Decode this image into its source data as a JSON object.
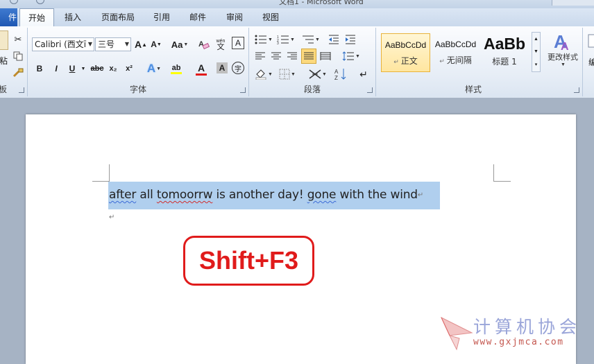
{
  "window": {
    "title": "文档1 - Microsoft Word"
  },
  "ribbon_tabs": {
    "file": "件",
    "items": [
      "开始",
      "插入",
      "页面布局",
      "引用",
      "邮件",
      "审阅",
      "视图"
    ],
    "active": "开始"
  },
  "clipboard": {
    "label": "板",
    "paste_label": "粘"
  },
  "font_group": {
    "label": "字体",
    "font_name": "Calibri (西文正文)",
    "font_name_shown": "Calibri (西文ī",
    "font_size": "三号",
    "grow": "A",
    "shrink": "A",
    "change_case": "Aa",
    "clear_format": "A",
    "phonetic": "wén",
    "char_border": "A",
    "bold": "B",
    "italic": "I",
    "underline": "U",
    "strikethrough": "abc",
    "subscript": "x₂",
    "superscript": "x²",
    "text_effects": "A",
    "highlight": "ab",
    "font_color": "A",
    "char_shading": "A",
    "enclose": "字"
  },
  "paragraph_group": {
    "label": "段落"
  },
  "styles_group": {
    "label": "样式",
    "styles": [
      {
        "sample": "AaBbCcDd",
        "name": "正文",
        "selected": true
      },
      {
        "sample": "AaBbCcDd",
        "name": "无间隔",
        "selected": false
      },
      {
        "sample": "AaBb",
        "name": "标题 1",
        "selected": false
      }
    ],
    "change_styles": "更改样式"
  },
  "editing_group": {
    "label": "编"
  },
  "document": {
    "line_parts": [
      {
        "text": "after",
        "mark": "blue"
      },
      {
        "text": " all ",
        "mark": "none"
      },
      {
        "text": "tomoorrw",
        "mark": "red"
      },
      {
        "text": " is another day! ",
        "mark": "none"
      },
      {
        "text": "gone",
        "mark": "blue"
      },
      {
        "text": " with the wind",
        "mark": "none"
      }
    ],
    "paragraph_mark": "↵",
    "shortcut_callout": "Shift+F3"
  },
  "watermark": {
    "cn": "计算机协会",
    "url": "www.gxjmca.com"
  },
  "colors": {
    "highlight_selection": "#b0cfee",
    "callout_red": "#e01b1b",
    "style_selected": "#ffe6a0",
    "file_tab": "#2a64c0"
  }
}
